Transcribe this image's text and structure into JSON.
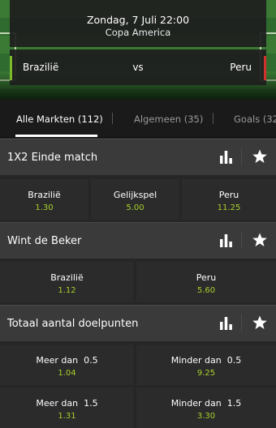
{
  "event": {
    "datetime": "Zondag, 7 Juli 22:00",
    "tournament": "Copa America",
    "home": "Brazilië",
    "vs": "vs",
    "away": "Peru",
    "colors": {
      "home_marker": "#7cba2c",
      "away_marker": "#d2322d",
      "odds": "#a7d02b"
    }
  },
  "tabs": [
    {
      "label": "Alle Markten (112)",
      "active": true
    },
    {
      "label": "Algemeen (35)",
      "active": false
    },
    {
      "label": "Goals (32)",
      "active": false
    }
  ],
  "markets": [
    {
      "title": "1X2 Einde match",
      "icons": [
        "stats-icon",
        "star-icon"
      ],
      "outcomes": [
        {
          "label": "Brazilië",
          "odds": "1.30"
        },
        {
          "label": "Gelijkspel",
          "odds": "5.00"
        },
        {
          "label": "Peru",
          "odds": "11.25"
        }
      ]
    },
    {
      "title": "Wint de Beker",
      "icons": [
        "stats-icon",
        "star-icon"
      ],
      "outcomes": [
        {
          "label": "Brazilië",
          "odds": "1.12"
        },
        {
          "label": "Peru",
          "odds": "5.60"
        }
      ]
    },
    {
      "title": "Totaal aantal doelpunten",
      "icons": [
        "stats-icon",
        "star-icon"
      ],
      "outcomes": [
        {
          "label": "Meer dan  0.5",
          "odds": "1.04"
        },
        {
          "label": "Minder dan  0.5",
          "odds": "9.25"
        },
        {
          "label": "Meer dan  1.5",
          "odds": "1.31"
        },
        {
          "label": "Minder dan  1.5",
          "odds": "3.30"
        }
      ]
    }
  ]
}
